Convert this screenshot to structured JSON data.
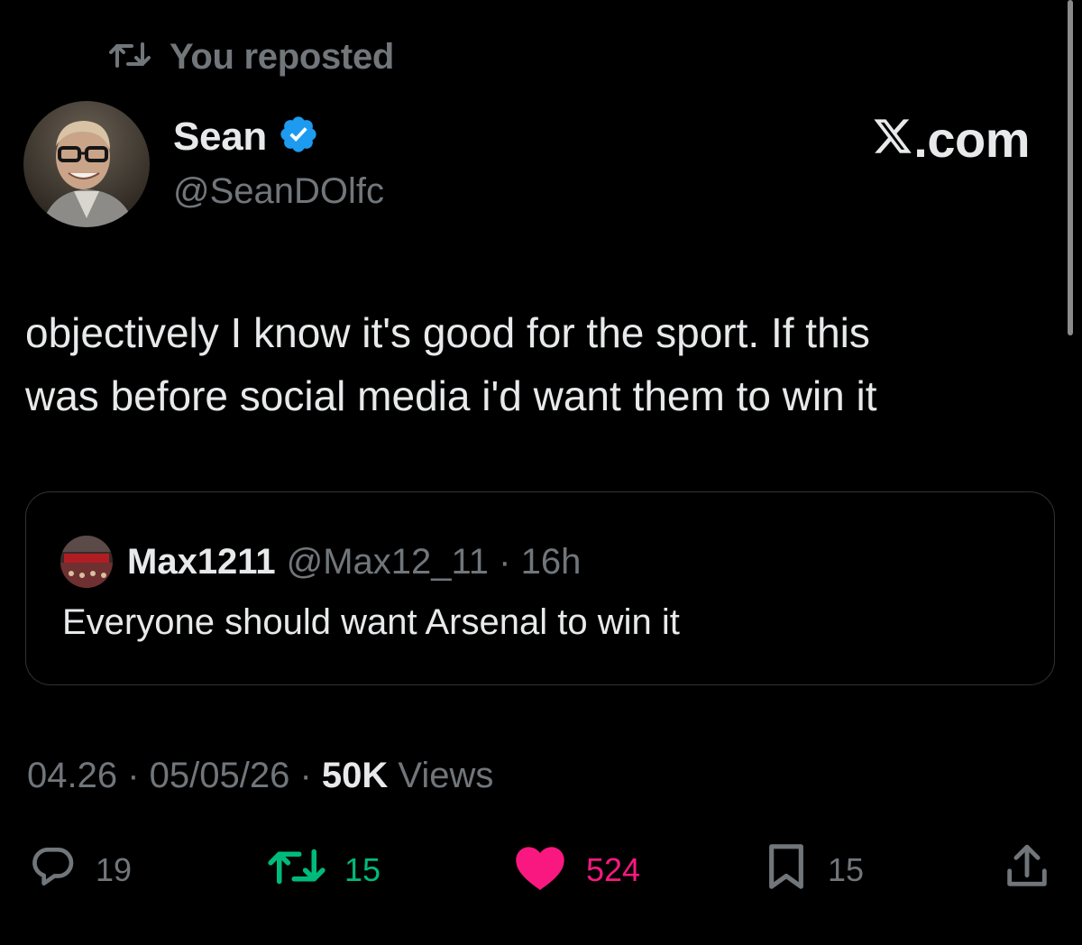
{
  "repost": {
    "label": "You reposted"
  },
  "author": {
    "name": "Sean",
    "handle": "@SeanDOlfc",
    "verified": true
  },
  "brand": {
    "text": ".com",
    "logo": "x-logo"
  },
  "tweet": {
    "text_line1": "objectively I know it's good for the sport. If this",
    "text_line2": "was before social media i'd want them to win it"
  },
  "quote": {
    "name": "Max1211",
    "handle_time": "@Max12_11 · 16h",
    "text": "Everyone should want Arsenal to win it"
  },
  "meta": {
    "time": "04.26 · 05/05/26 · ",
    "views_count": "50K",
    "views_label": " Views"
  },
  "actions": {
    "replies": "19",
    "reposts": "15",
    "likes": "524",
    "bookmarks": "15"
  },
  "colors": {
    "background": "#000000",
    "text": "#e7e9ea",
    "muted": "#71767b",
    "verified": "#1d9bf0",
    "repost_green": "#00ba7c",
    "like_pink": "#f91880"
  },
  "icons": [
    "repost-icon",
    "verified-badge-icon",
    "x-logo-icon",
    "reply-icon",
    "like-icon",
    "bookmark-icon",
    "share-icon"
  ]
}
